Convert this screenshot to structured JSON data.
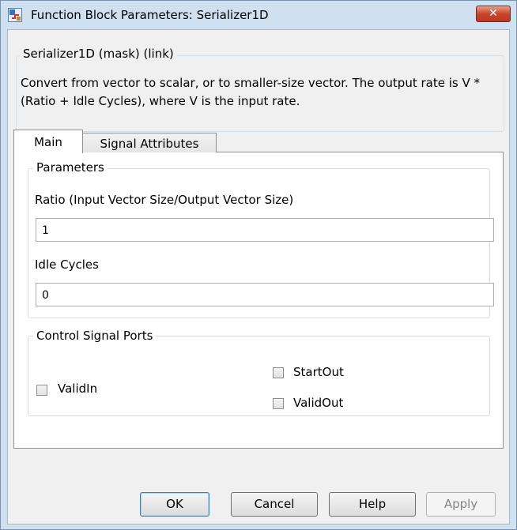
{
  "window": {
    "title": "Function Block Parameters: Serializer1D",
    "close_label": "✕"
  },
  "description": {
    "legend": "Serializer1D (mask) (link)",
    "text": "Convert from vector to scalar, or to smaller-size vector. The output rate is V * (Ratio + Idle Cycles), where V is the input rate."
  },
  "tabs": [
    {
      "label": "Main",
      "selected": true
    },
    {
      "label": "Signal Attributes",
      "selected": false
    }
  ],
  "parameters": {
    "legend": "Parameters",
    "ratio_label": "Ratio (Input Vector Size/Output Vector Size)",
    "ratio_value": "1",
    "idle_label": "Idle Cycles",
    "idle_value": "0"
  },
  "control_ports": {
    "legend": "Control Signal Ports",
    "validin_label": "ValidIn",
    "validin_checked": false,
    "startout_label": "StartOut",
    "startout_checked": false,
    "validout_label": "ValidOut",
    "validout_checked": false
  },
  "buttons": {
    "ok": "OK",
    "cancel": "Cancel",
    "help": "Help",
    "apply": "Apply"
  },
  "colors": {
    "window_frame": "#cfe0f1",
    "close_button": "#c7462c"
  }
}
